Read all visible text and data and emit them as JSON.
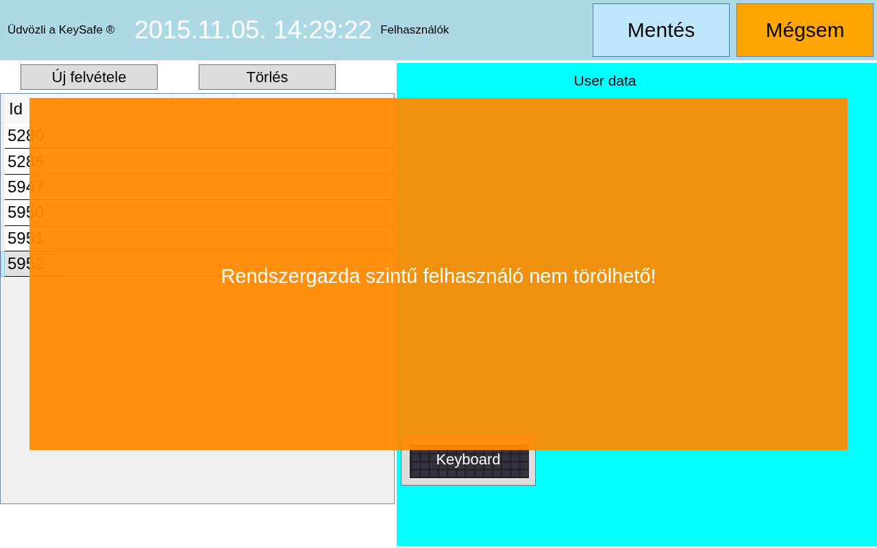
{
  "header": {
    "greeting": "Üdvözli a KeySafe ®",
    "datetime": "2015.11.05. 14:29:22",
    "section": "Felhasználók",
    "buttons": [
      {
        "label": "Mentés",
        "kind": "save"
      },
      {
        "label": "Mégsem",
        "kind": "cancel"
      }
    ]
  },
  "toolbar": {
    "buttons": [
      "Új felvétele",
      "Törlés"
    ]
  },
  "table": {
    "columns": [
      "Id"
    ],
    "rows": [
      {
        "id": "5280",
        "selected": false
      },
      {
        "id": "5286",
        "selected": false
      },
      {
        "id": "5947",
        "selected": false
      },
      {
        "id": "5950",
        "selected": false
      },
      {
        "id": "5951",
        "selected": false
      },
      {
        "id": "5952",
        "selected": true
      }
    ]
  },
  "user_data": {
    "title": "User data",
    "keyboard_button": "Keyboard"
  },
  "message": {
    "text": "Rendszergazda szintű felhasználó nem törölhető!"
  }
}
